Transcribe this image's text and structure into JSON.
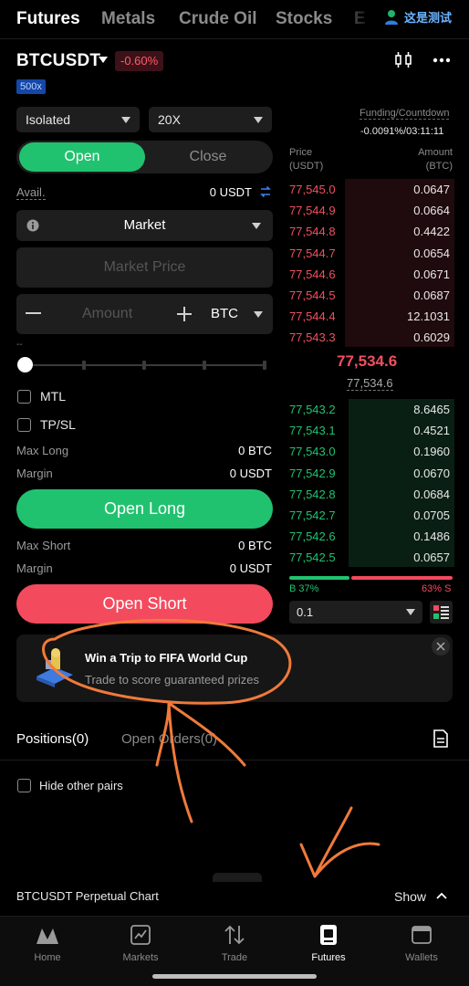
{
  "top_tabs": [
    "Futures",
    "Metals",
    "Crude Oil",
    "Stocks",
    "E"
  ],
  "user": {
    "name": "这是测试"
  },
  "header": {
    "pair": "BTCUSDT",
    "change": "-0.60%",
    "leverage_badge": "500x"
  },
  "form": {
    "margin_mode": "Isolated",
    "leverage": "20X",
    "open_label": "Open",
    "close_label": "Close",
    "avail_label": "Avail.",
    "avail_value": "0 USDT",
    "order_type": "Market",
    "price_placeholder": "Market Price",
    "amount_placeholder": "Amount",
    "amount_unit": "BTC",
    "dash": "--",
    "slider_percent": 0,
    "mtl_label": "MTL",
    "tpsl_label": "TP/SL",
    "max_long_label": "Max Long",
    "max_long_value": "0 BTC",
    "margin_label": "Margin",
    "margin_long_value": "0 USDT",
    "open_long_label": "Open Long",
    "max_short_label": "Max Short",
    "max_short_value": "0 BTC",
    "margin_short_value": "0 USDT",
    "open_short_label": "Open Short"
  },
  "orderbook": {
    "funding_label": "Funding/Countdown",
    "funding_value": "-0.0091%/03:11:11",
    "price_header": "Price",
    "price_unit": "(USDT)",
    "amount_header": "Amount",
    "amount_unit": "(BTC)",
    "asks": [
      {
        "price": "77,545.0",
        "amount": "0.0647"
      },
      {
        "price": "77,544.9",
        "amount": "0.0664"
      },
      {
        "price": "77,544.8",
        "amount": "0.4422"
      },
      {
        "price": "77,544.7",
        "amount": "0.0654"
      },
      {
        "price": "77,544.6",
        "amount": "0.0671"
      },
      {
        "price": "77,544.5",
        "amount": "0.0687"
      },
      {
        "price": "77,544.4",
        "amount": "12.1031"
      },
      {
        "price": "77,543.3",
        "amount": "0.6029"
      }
    ],
    "last_price": "77,534.6",
    "mark_price": "77,534.6",
    "bids": [
      {
        "price": "77,543.2",
        "amount": "8.6465"
      },
      {
        "price": "77,543.1",
        "amount": "0.4521"
      },
      {
        "price": "77,543.0",
        "amount": "0.1960"
      },
      {
        "price": "77,542.9",
        "amount": "0.0670"
      },
      {
        "price": "77,542.8",
        "amount": "0.0684"
      },
      {
        "price": "77,542.7",
        "amount": "0.0705"
      },
      {
        "price": "77,542.6",
        "amount": "0.1486"
      },
      {
        "price": "77,542.5",
        "amount": "0.0657"
      }
    ],
    "buy_ratio": "B 37%",
    "sell_ratio": "63% S",
    "depth_value": "0.1"
  },
  "banner": {
    "title": "Win a Trip to FIFA World Cup",
    "subtitle": "Trade to score guaranteed prizes"
  },
  "positions": {
    "tab_positions": "Positions(0)",
    "tab_orders": "Open Orders(0)",
    "hide_pairs_label": "Hide other pairs"
  },
  "chart_bar": {
    "label": "BTCUSDT Perpetual Chart",
    "show_label": "Show"
  },
  "nav": [
    {
      "label": "Home",
      "icon": "home-icon"
    },
    {
      "label": "Markets",
      "icon": "markets-icon"
    },
    {
      "label": "Trade",
      "icon": "trade-icon"
    },
    {
      "label": "Futures",
      "icon": "futures-icon"
    },
    {
      "label": "Wallets",
      "icon": "wallet-icon"
    }
  ],
  "colors": {
    "green": "#21c26f",
    "red": "#f34a5e",
    "badge_blue": "#1547a8",
    "annotation": "#f07a3a"
  }
}
